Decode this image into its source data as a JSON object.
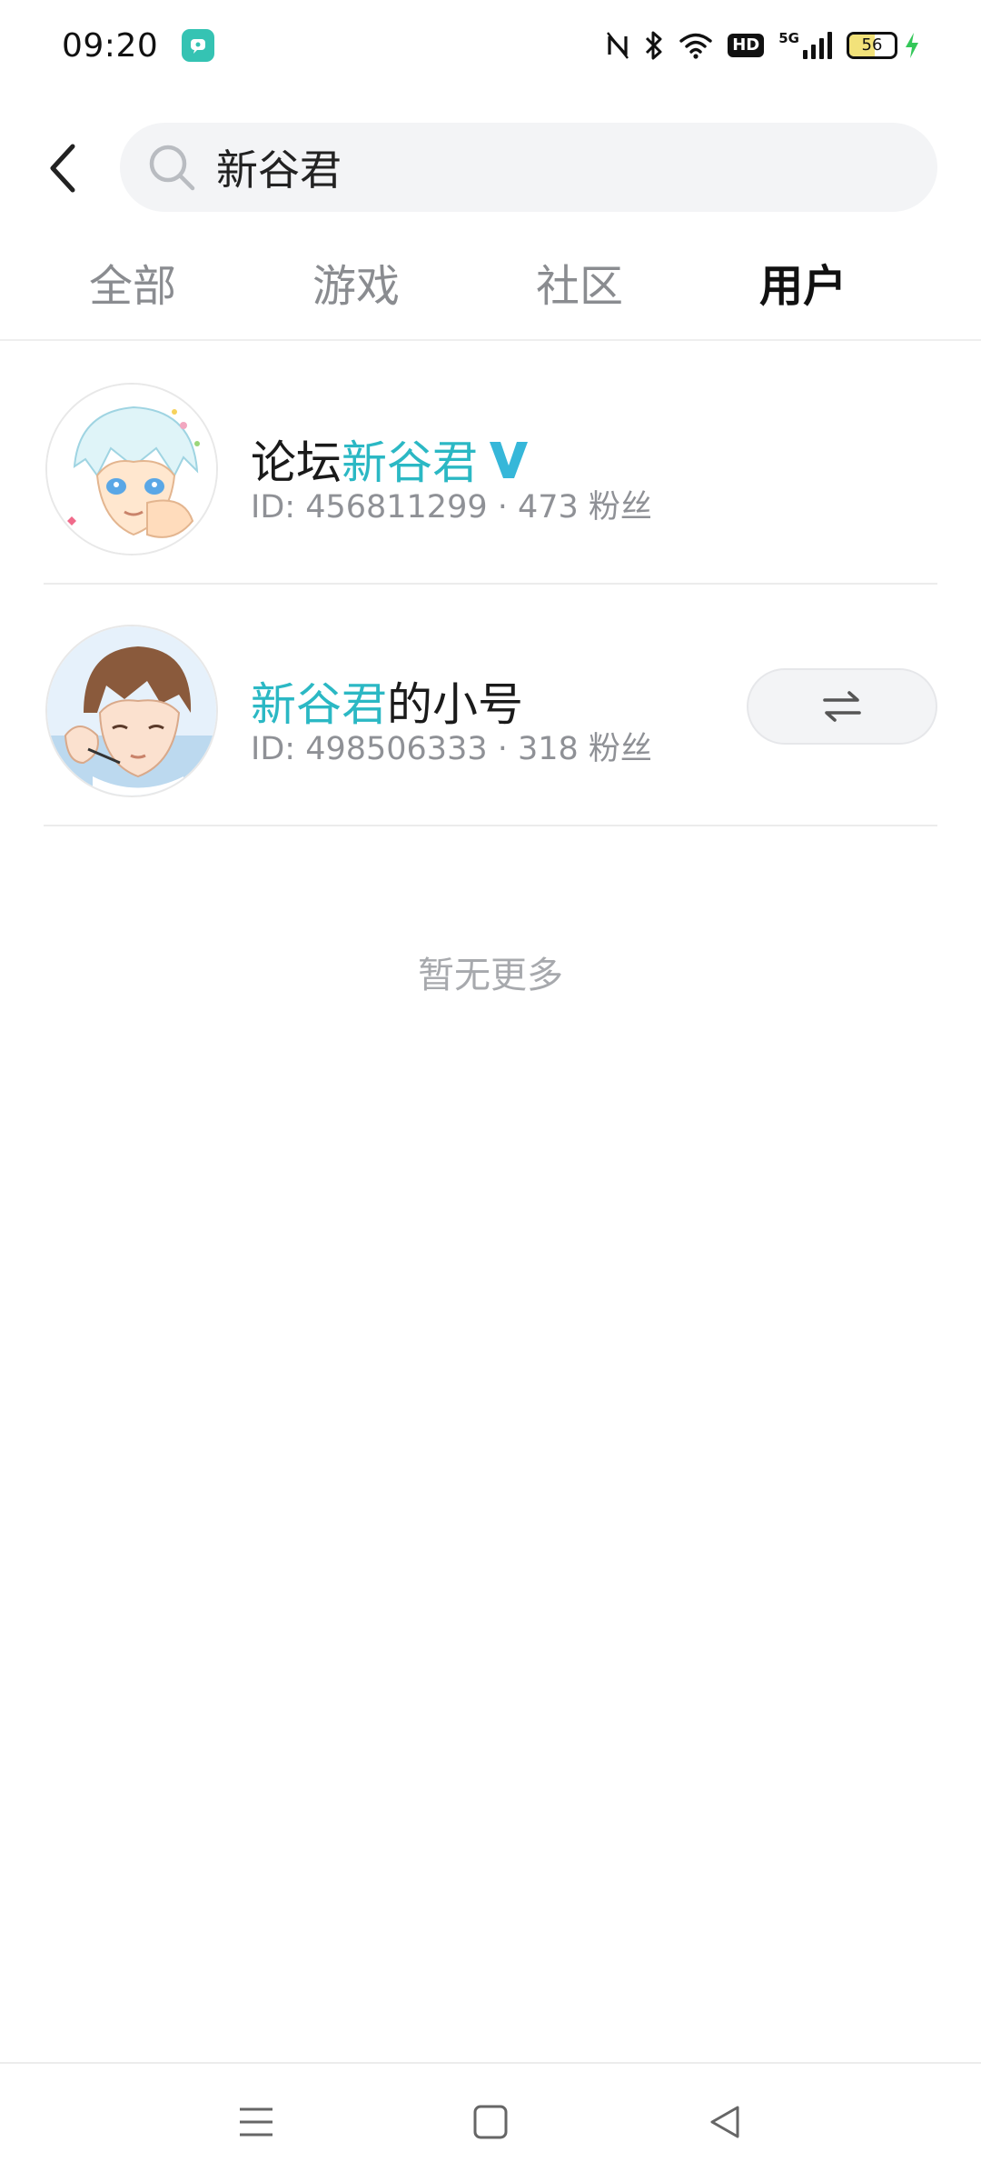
{
  "status_bar": {
    "time": "09:20",
    "network_label": "5G",
    "hd_label": "HD",
    "battery_level": "56",
    "icons": [
      "app-notification-icon",
      "nfc-icon",
      "bluetooth-icon",
      "wifi-icon",
      "hd-icon",
      "signal-icon",
      "battery-icon",
      "charging-icon"
    ]
  },
  "search": {
    "query": "新谷君",
    "icons": [
      "back-arrow-icon",
      "search-icon"
    ]
  },
  "tabs": [
    {
      "label": "全部",
      "active": false
    },
    {
      "label": "游戏",
      "active": false
    },
    {
      "label": "社区",
      "active": false
    },
    {
      "label": "用户",
      "active": true
    }
  ],
  "users": [
    {
      "name_prefix": "论坛",
      "name_highlight": "新谷君",
      "name_suffix": "",
      "verified": true,
      "meta": "ID: 456811299 · 473 粉丝",
      "has_switch_button": false
    },
    {
      "name_prefix": "",
      "name_highlight": "新谷君",
      "name_suffix": "的小号",
      "verified": false,
      "meta": "ID: 498506333 · 318 粉丝",
      "has_switch_button": true
    }
  ],
  "list_footer": "暂无更多",
  "colors": {
    "accent": "#2bb8c4",
    "tab_indicator": "#1eb3c3",
    "muted_text": "#8f9196",
    "verified_badge": "#36b7d9"
  },
  "nav_bar": {
    "icons": [
      "menu-icon",
      "home-icon",
      "back-icon"
    ]
  }
}
